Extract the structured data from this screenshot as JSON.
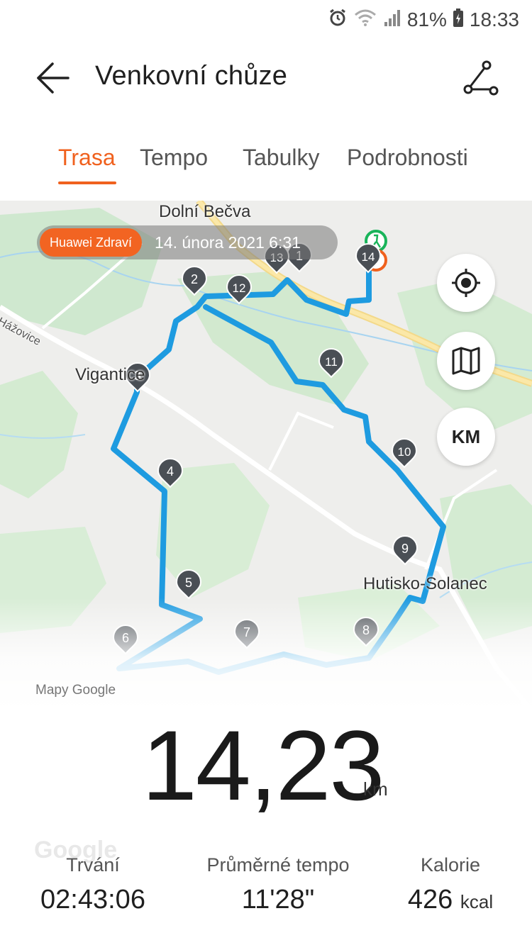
{
  "status_bar": {
    "battery": "81%",
    "time": "18:33"
  },
  "header": {
    "title": "Venkovní chůze"
  },
  "tabs": [
    {
      "label": "Trasa",
      "active": true
    },
    {
      "label": "Tempo",
      "active": false
    },
    {
      "label": "Tabulky",
      "active": false
    },
    {
      "label": "Podrobnosti",
      "active": false
    }
  ],
  "map": {
    "source_tag": "Huawei Zdraví",
    "date": "14. února 2021 6:31",
    "place_labels": [
      "Dolní Bečva",
      "Vigantice",
      "Hutisko-Solanec",
      "Hážovice"
    ],
    "km_button": "KM",
    "attribution": "Mapy Google",
    "markers": [
      "1",
      "2",
      "3",
      "4",
      "5",
      "6",
      "7",
      "8",
      "9",
      "10",
      "11",
      "12",
      "13",
      "14"
    ],
    "route_color": "#1e9be0",
    "accent_color": "#f0611e"
  },
  "summary": {
    "distance": "14,23",
    "distance_unit": "km"
  },
  "watermark": "Google",
  "stats": {
    "duration_label": "Trvání",
    "duration_value": "02:43:06",
    "pace_label": "Průměrné tempo",
    "pace_value": "11'28\"",
    "calories_label": "Kalorie",
    "calories_value": "426",
    "calories_unit": "kcal"
  }
}
